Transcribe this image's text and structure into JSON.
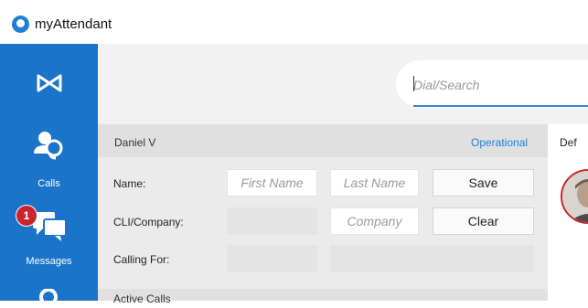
{
  "app": {
    "title": "myAttendant"
  },
  "sidebar": {
    "items": [
      {
        "label": "",
        "icon": "attendant-logo-icon"
      },
      {
        "label": "Calls",
        "icon": "calls-icon"
      },
      {
        "label": "Messages",
        "icon": "messages-icon",
        "badge": "1"
      },
      {
        "label": "",
        "icon": "contacts-icon"
      }
    ]
  },
  "search": {
    "placeholder": "Dial/Search"
  },
  "caller": {
    "name": "Daniel V",
    "status": "Operational",
    "fields": {
      "name_label": "Name:",
      "first_name_placeholder": "First Name",
      "last_name_placeholder": "Last Name",
      "cli_label": "CLI/Company:",
      "company_placeholder": "Company",
      "calling_for_label": "Calling For:"
    },
    "buttons": {
      "save": "Save",
      "clear": "Clear"
    }
  },
  "right_panel": {
    "header": "Def"
  },
  "active_calls": {
    "label": "Active Calls"
  },
  "colors": {
    "accent": "#1a74c9",
    "badge": "#c8262c",
    "status": "#1f7fd8"
  }
}
